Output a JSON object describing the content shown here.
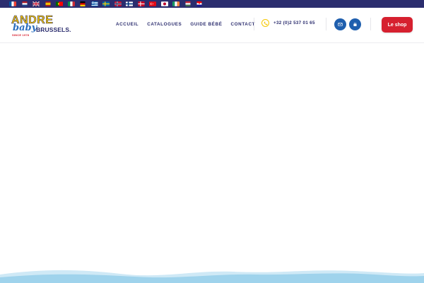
{
  "flags": [
    {
      "name": "france-flag-icon"
    },
    {
      "name": "netherlands-flag-icon"
    },
    {
      "name": "uk-flag-icon"
    },
    {
      "name": "spain-flag-icon"
    },
    {
      "name": "portugal-flag-icon"
    },
    {
      "name": "italy-flag-icon"
    },
    {
      "name": "germany-flag-icon"
    },
    {
      "name": "greece-flag-icon"
    },
    {
      "name": "sweden-flag-icon"
    },
    {
      "name": "norway-flag-icon"
    },
    {
      "name": "finland-flag-icon"
    },
    {
      "name": "denmark-flag-icon"
    },
    {
      "name": "turkey-flag-icon"
    },
    {
      "name": "japan-flag-icon"
    },
    {
      "name": "ireland-flag-icon"
    },
    {
      "name": "hungary-flag-icon"
    },
    {
      "name": "croatia-flag-icon"
    }
  ],
  "logo": {
    "andre": "ANDRE",
    "baby": "baby",
    "brussels": "BRUSSELS.",
    "since": "SINCE 1978"
  },
  "nav": {
    "items": [
      "ACCUEIL",
      "CATALOGUES",
      "GUIDE BÉBÉ",
      "CONTACT"
    ]
  },
  "phone": {
    "icon": "phone-icon",
    "number": "+32 (0)2 537 01 65"
  },
  "social": {
    "email_icon": "email-icon",
    "youtube_icon": "youtube-icon"
  },
  "shop_button": {
    "label": "Le shop"
  },
  "colors": {
    "topbar": "#2b2d6e",
    "brand_yellow": "#f6c800",
    "brand_navy": "#2b2d6e",
    "shop_red": "#d6202f",
    "circle_blue": "#1f5fae",
    "wave_light": "#b9e1f3",
    "wave_dark": "#8fcbe8"
  }
}
